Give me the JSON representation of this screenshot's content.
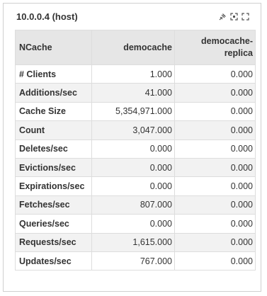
{
  "panel": {
    "title": "10.0.0.4 (host)",
    "tools": [
      "pin-icon",
      "expand-icon",
      "fullscreen-icon"
    ]
  },
  "table": {
    "headers": [
      "NCache",
      "democache",
      "democache-\nreplica"
    ],
    "rows": [
      {
        "label": "# Clients",
        "democache": "1.000",
        "replica": "0.000"
      },
      {
        "label": "Additions/sec",
        "democache": "41.000",
        "replica": "0.000"
      },
      {
        "label": "Cache Size",
        "democache": "5,354,971.000",
        "replica": "0.000"
      },
      {
        "label": "Count",
        "democache": "3,047.000",
        "replica": "0.000"
      },
      {
        "label": "Deletes/sec",
        "democache": "0.000",
        "replica": "0.000"
      },
      {
        "label": "Evictions/sec",
        "democache": "0.000",
        "replica": "0.000"
      },
      {
        "label": "Expirations/sec",
        "democache": "0.000",
        "replica": "0.000"
      },
      {
        "label": "Fetches/sec",
        "democache": "807.000",
        "replica": "0.000"
      },
      {
        "label": "Queries/sec",
        "democache": "0.000",
        "replica": "0.000"
      },
      {
        "label": "Requests/sec",
        "democache": "1,615.000",
        "replica": "0.000"
      },
      {
        "label": "Updates/sec",
        "democache": "767.000",
        "replica": "0.000"
      }
    ]
  }
}
